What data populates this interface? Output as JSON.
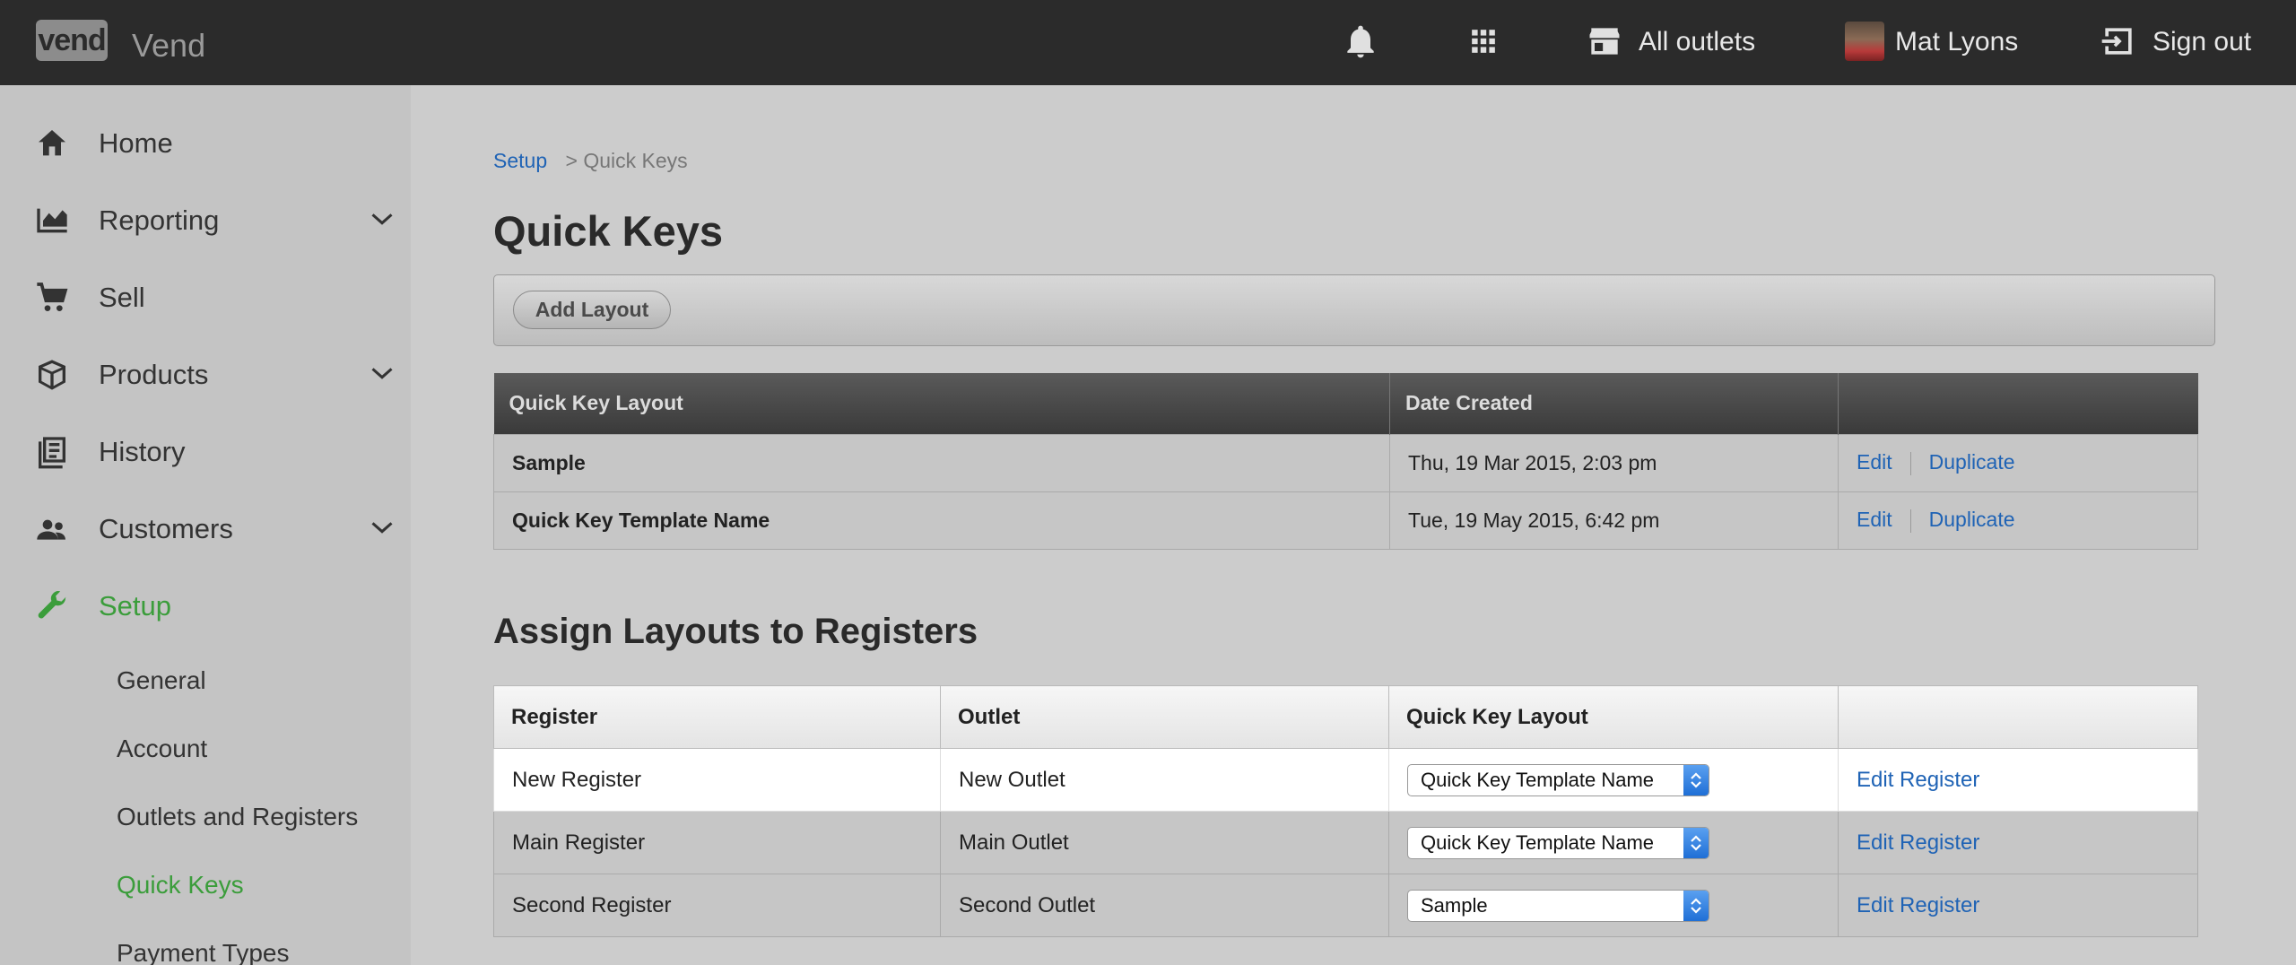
{
  "app": {
    "logo_badge": "vend",
    "name": "Vend"
  },
  "topbar": {
    "outlets_label": "All outlets",
    "user_name": "Mat Lyons",
    "signout_label": "Sign out"
  },
  "sidebar": {
    "items": [
      {
        "label": "Home"
      },
      {
        "label": "Reporting"
      },
      {
        "label": "Sell"
      },
      {
        "label": "Products"
      },
      {
        "label": "History"
      },
      {
        "label": "Customers"
      },
      {
        "label": "Setup"
      }
    ],
    "setup_sub": [
      {
        "label": "General"
      },
      {
        "label": "Account"
      },
      {
        "label": "Outlets and Registers"
      },
      {
        "label": "Quick Keys"
      },
      {
        "label": "Payment Types"
      }
    ]
  },
  "breadcrumb": {
    "root": "Setup",
    "current": "> Quick Keys"
  },
  "page_title": "Quick Keys",
  "toolbar": {
    "add_layout_label": "Add Layout"
  },
  "layouts_table": {
    "headers": [
      "Quick Key Layout",
      "Date Created",
      ""
    ],
    "rows": [
      {
        "name": "Sample",
        "date": "Thu, 19 Mar 2015, 2:03 pm",
        "edit": "Edit",
        "duplicate": "Duplicate"
      },
      {
        "name": "Quick Key Template Name",
        "date": "Tue, 19 May 2015, 6:42 pm",
        "edit": "Edit",
        "duplicate": "Duplicate"
      }
    ]
  },
  "assign_title": "Assign Layouts to Registers",
  "registers_table": {
    "headers": [
      "Register",
      "Outlet",
      "Quick Key Layout",
      ""
    ],
    "rows": [
      {
        "register": "New Register",
        "outlet": "New Outlet",
        "layout": "Quick Key Template Name",
        "action": "Edit Register"
      },
      {
        "register": "Main Register",
        "outlet": "Main Outlet",
        "layout": "Quick Key Template Name",
        "action": "Edit Register"
      },
      {
        "register": "Second Register",
        "outlet": "Second Outlet",
        "layout": "Sample",
        "action": "Edit Register"
      }
    ]
  },
  "colors": {
    "topbar": "#2b2b2b",
    "accent_green": "#3b9d3b",
    "link_blue": "#1f63b5"
  }
}
